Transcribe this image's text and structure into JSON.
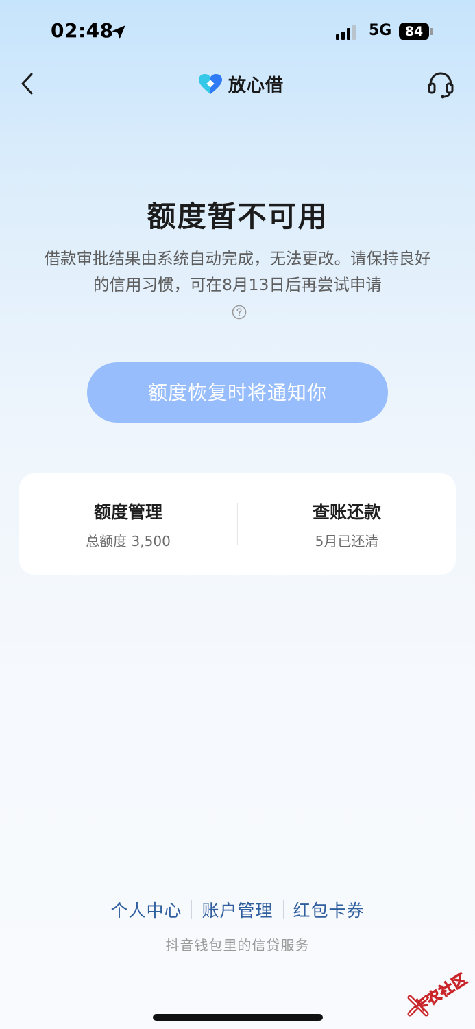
{
  "status_bar": {
    "time": "02:48",
    "network": "5G",
    "battery": "84",
    "icons": [
      "location-arrow-icon",
      "signal-bars-icon",
      "battery-icon"
    ]
  },
  "nav": {
    "brand_name": "放心借",
    "back_icon": "chevron-left-icon",
    "service_icon": "headset-icon",
    "logo_colors": {
      "cyan": "#35c8e9",
      "blue": "#2f7bf5"
    }
  },
  "main": {
    "title": "额度暂不可用",
    "description": "借款审批结果由系统自动完成，无法更改。请保持良好的信用习惯，可在8月13日后再尝试申请",
    "help_icon": "question-circle-icon",
    "notify_button_label": "额度恢复时将通知你",
    "notify_button_color": "#97bdfc"
  },
  "card": {
    "left": {
      "title": "额度管理",
      "subtitle": "总额度 3,500"
    },
    "right": {
      "title": "查账还款",
      "subtitle": "5月已还清"
    }
  },
  "footer": {
    "links": [
      "个人中心",
      "账户管理",
      "红包卡券"
    ],
    "note": "抖音钱包里的信贷服务",
    "link_color": "#2f5f9f"
  },
  "watermark": {
    "text": "卡农社区",
    "color": "#c8262b"
  }
}
